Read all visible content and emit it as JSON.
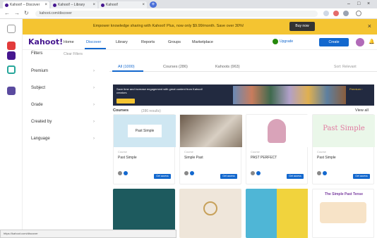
{
  "browser": {
    "tabs": [
      {
        "label": "Kahoot! – Discover"
      },
      {
        "label": "Kahoot! – Library"
      },
      {
        "label": "Kahoot!"
      }
    ],
    "url": "kahoot.com/discover"
  },
  "banner": {
    "text": "Empower knowledge sharing with Kahoot! Plus, now only $9.99/month. Save over 30%!",
    "button": "Buy now"
  },
  "header": {
    "logo": "Kahoot!",
    "nav": [
      "Home",
      "Discover",
      "Library",
      "Reports",
      "Groups",
      "Marketplace"
    ],
    "upgrade": "Upgrade",
    "create": "Create"
  },
  "filters": {
    "label": "Filters",
    "hint": "Clear Filters"
  },
  "sidebar": {
    "items": [
      "Premium",
      "Subject",
      "Grade",
      "Created by",
      "Language"
    ]
  },
  "content_tabs": {
    "tabs": [
      "All (1000)",
      "Courses (286)",
      "Kahoots (963)"
    ],
    "sort": "Sort: Relevant"
  },
  "hero": {
    "text": "Save time and increase engagement with great content from Kahoot! creators",
    "cta": "Premium ›"
  },
  "section": {
    "title": "Courses",
    "subtitle": "(286 results)",
    "view_all": "View all"
  },
  "cards": [
    {
      "title": "Past Simple",
      "meta": "Course",
      "thumb_text": "Past Simple",
      "button": "Get access"
    },
    {
      "title": "Simple Past",
      "meta": "Course",
      "thumb_text": "",
      "button": "Get access"
    },
    {
      "title": "PAST PERFECT",
      "meta": "Course",
      "thumb_text": "",
      "button": "Get access"
    },
    {
      "title": "Past Simple",
      "meta": "Course",
      "thumb_text": "Past Simple",
      "button": "Get access"
    }
  ],
  "cards_row2": [
    {
      "thumb_text": ""
    },
    {
      "thumb_text": ""
    },
    {
      "thumb_text": ""
    },
    {
      "thumb_text": "The Simple Past Tense"
    }
  ],
  "statusbar": {
    "text": "https://kahoot.com/discover"
  },
  "colors": {
    "brand": "#46178f",
    "accent": "#1368ce",
    "banner": "#f4c431",
    "upgrade_dot": "#26890c"
  }
}
